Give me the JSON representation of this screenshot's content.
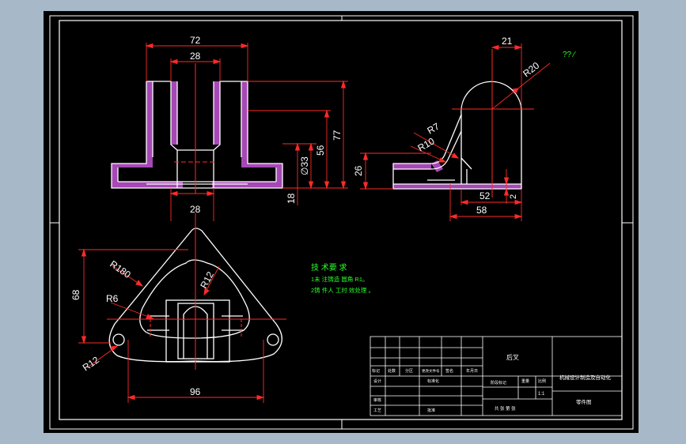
{
  "colors": {
    "background": "#a7b8c9",
    "sheet": "#000000",
    "outline": "#ffffff",
    "dimension": "#ff2a2a",
    "hatch": "#c455d6",
    "note": "#29ff29"
  },
  "top_view": {
    "dim_overall_width": "72",
    "dim_inner_width": "28",
    "dim_bottom_width": "28",
    "dim_height_77": "77",
    "dim_height_56": "56",
    "dim_diameter": "∅33",
    "dim_base_thickness": "18"
  },
  "side_view": {
    "dim_top_offset": "21",
    "dim_radius_20": "R20",
    "dim_radius_7": "R7",
    "dim_radius_10": "R10",
    "dim_height_26": "26",
    "dim_52": "52",
    "dim_2": "2",
    "dim_58": "58",
    "surface_mark": "?? ⁄"
  },
  "plan_view": {
    "dim_68": "68",
    "dim_r180": "R180",
    "dim_r6": "R6",
    "dim_r12_inner": "R12",
    "dim_r12_corner": "R12",
    "dim_96": "96"
  },
  "tech_notes": {
    "title": "技 术要 求",
    "line1": "1未 注铸造 圆角 R1。",
    "line2": "2铸 件人 工时 效处理 。"
  },
  "title_block": {
    "part_name": "后叉",
    "school": "机械设计制造及自动化",
    "row_labels": [
      "标记",
      "处数",
      "分区",
      "更改文件号",
      "签名",
      "年月日"
    ],
    "design_label": "设计",
    "std_label": "标准化",
    "stage_label": "阶段标记",
    "weight_label": "重量",
    "scale_label": "比例",
    "scale_value": "1:1",
    "check_label": "审核",
    "craft_label": "工艺",
    "approve_label": "批准",
    "sheets_label": "共 张 第 张",
    "material_label": "零件图"
  }
}
